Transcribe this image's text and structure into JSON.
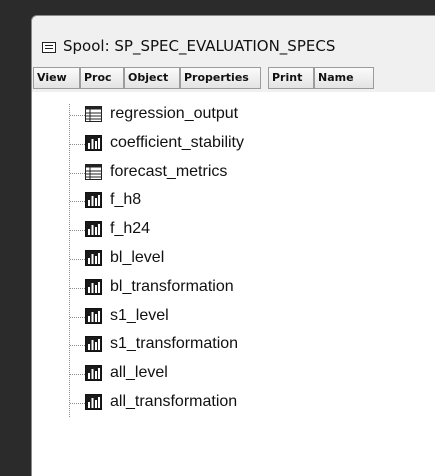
{
  "window": {
    "title": "Spool: SP_SPEC_EVALUATION_SPECS"
  },
  "toolbar": {
    "buttons": [
      "View",
      "Proc",
      "Object",
      "Properties",
      "Print",
      "Name"
    ]
  },
  "tree": {
    "items": [
      {
        "label": "regression_output",
        "icon": "table-icon"
      },
      {
        "label": "coefficient_stability",
        "icon": "graph-icon"
      },
      {
        "label": "forecast_metrics",
        "icon": "table-icon"
      },
      {
        "label": "f_h8",
        "icon": "graph-icon"
      },
      {
        "label": "f_h24",
        "icon": "graph-icon"
      },
      {
        "label": "bl_level",
        "icon": "graph-icon"
      },
      {
        "label": "bl_transformation",
        "icon": "graph-icon"
      },
      {
        "label": "s1_level",
        "icon": "graph-icon"
      },
      {
        "label": "s1_transformation",
        "icon": "graph-icon"
      },
      {
        "label": "all_level",
        "icon": "graph-icon"
      },
      {
        "label": "all_transformation",
        "icon": "graph-icon"
      }
    ]
  }
}
